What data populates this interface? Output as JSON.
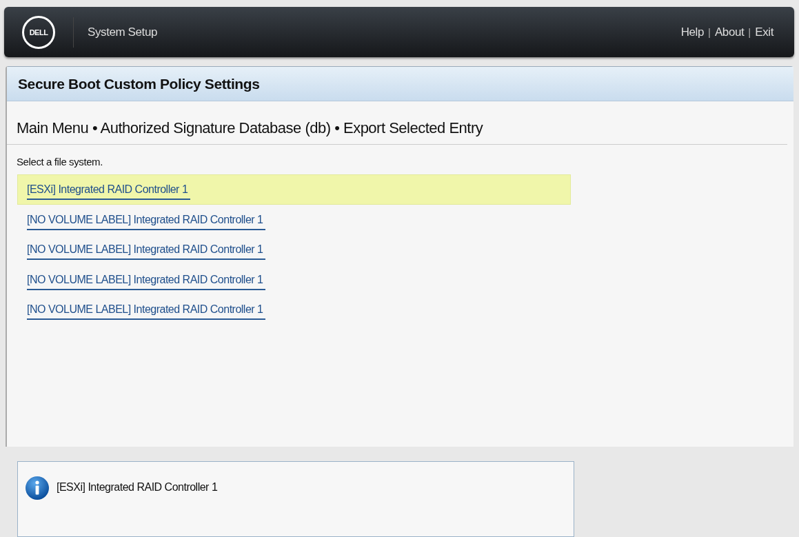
{
  "header": {
    "logo": "DELL",
    "title": "System Setup",
    "links": [
      {
        "label": "Help"
      },
      {
        "label": "About"
      },
      {
        "label": "Exit"
      }
    ],
    "separators": [
      "|",
      "|"
    ]
  },
  "panel": {
    "title": "Secure Boot Custom Policy Settings",
    "breadcrumb": "Main Menu • Authorized Signature Database (db) • Export Selected Entry",
    "prompt": "Select a file system.",
    "items": [
      {
        "label": "[ESXi] Integrated RAID Controller 1",
        "selected": true
      },
      {
        "label": "[NO VOLUME LABEL] Integrated RAID Controller 1",
        "selected": false
      },
      {
        "label": "[NO VOLUME LABEL] Integrated RAID Controller 1",
        "selected": false
      },
      {
        "label": "[NO VOLUME LABEL] Integrated RAID Controller 1",
        "selected": false
      },
      {
        "label": "[NO VOLUME LABEL] Integrated RAID Controller 1",
        "selected": false
      }
    ]
  },
  "info": {
    "text": "[ESXi] Integrated RAID Controller 1"
  }
}
